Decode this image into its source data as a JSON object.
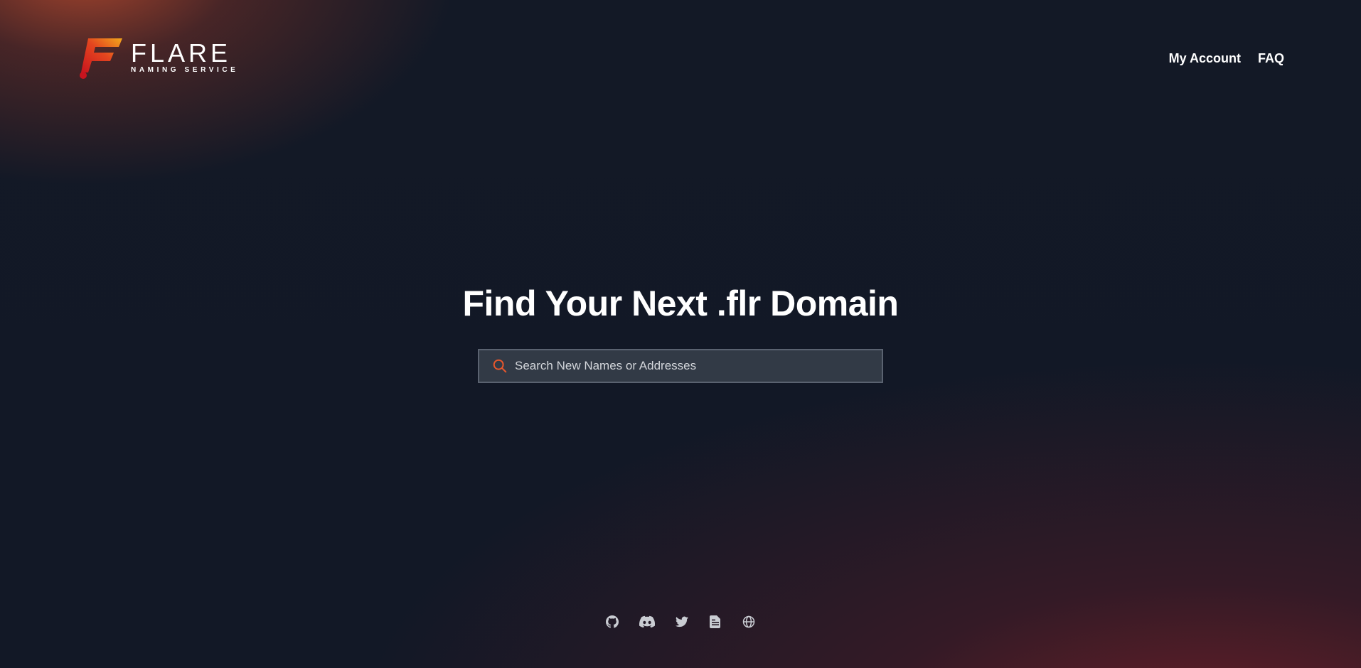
{
  "brand": {
    "name": "FLARE",
    "subtitle": "NAMING SERVICE",
    "accent_color": "#e8572c",
    "gradient_colors": [
      "#c8141e",
      "#f0a21c"
    ]
  },
  "nav": {
    "items": [
      {
        "label": "My Account"
      },
      {
        "label": "FAQ"
      }
    ]
  },
  "hero": {
    "title": "Find Your Next .flr Domain"
  },
  "search": {
    "placeholder": "Search New Names or Addresses",
    "value": "",
    "icon": "search-icon"
  },
  "footer": {
    "icons": [
      "github-icon",
      "discord-icon",
      "twitter-icon",
      "document-icon",
      "globe-icon"
    ],
    "icon_color": "#c9ccd2"
  }
}
